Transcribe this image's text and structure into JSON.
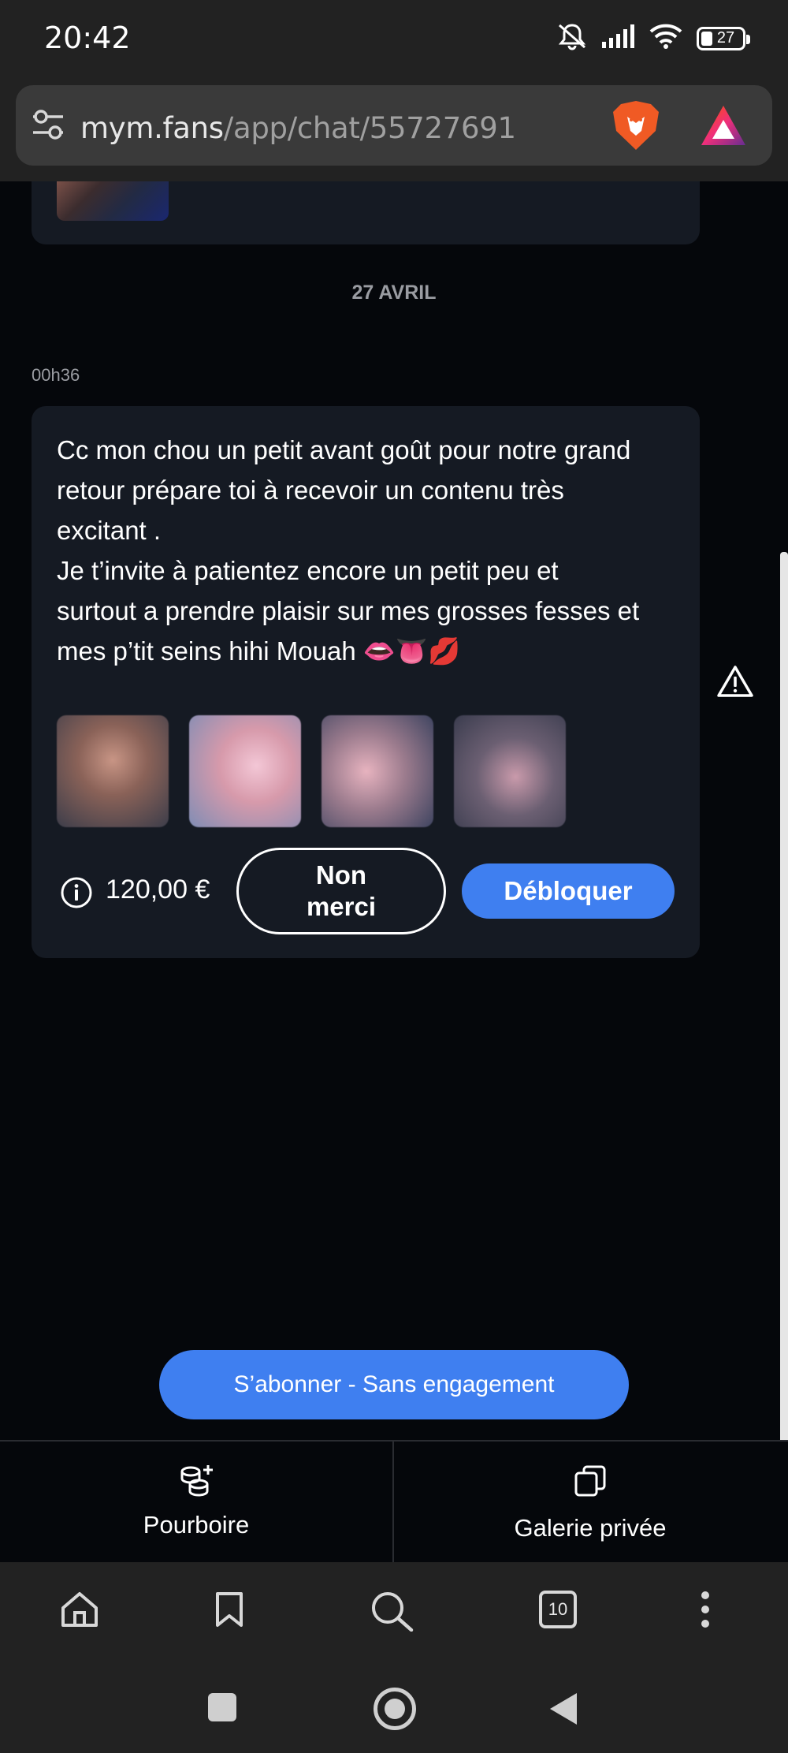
{
  "status_bar": {
    "time": "20:42",
    "battery": "27"
  },
  "browser": {
    "url_host": "mym.fans",
    "url_path": "/app/chat/55727691"
  },
  "chat": {
    "date_separator": "27 AVRIL",
    "message_time": "00h36",
    "message_text": "Cc mon chou un petit avant goût pour notre grand\nretour prépare toi à recevoir un contenu très\nexcitant .\nJe t’invite à patientez encore un petit peu et\nsurtout a prendre plaisir sur mes grosses fesses et\nmes p’tit seins hihi Mouah 👄👅💋",
    "price": "120,00 €",
    "decline_label": "Non\nmerci",
    "unlock_label": "Débloquer"
  },
  "subscribe": {
    "label": "S’abonner - Sans engagement"
  },
  "bottom_tabs": {
    "tip_label": "Pourboire",
    "gallery_label": "Galerie privée"
  },
  "browser_nav": {
    "tab_count": "10"
  },
  "colors": {
    "accent": "#3f7ff0",
    "bubble": "#151a23",
    "background": "#05070b",
    "chrome": "#222222"
  }
}
